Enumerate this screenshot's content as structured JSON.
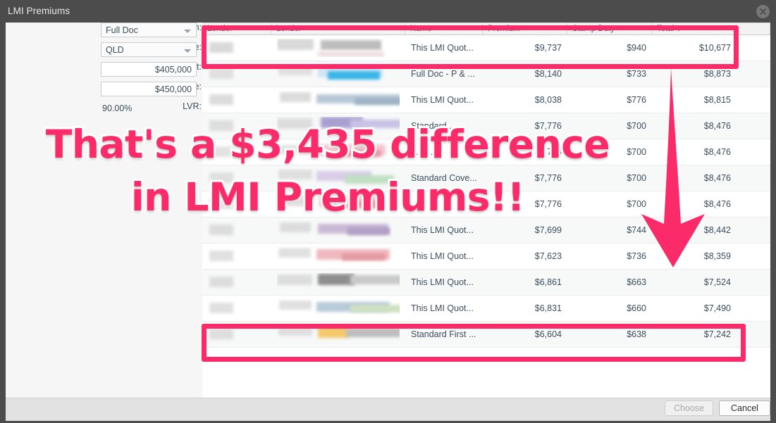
{
  "window": {
    "title": "LMI Premiums",
    "close_icon": "close-circle-icon"
  },
  "form": {
    "fields": [
      {
        "label": "Income Verification:",
        "value": "Full Doc",
        "type": "select"
      },
      {
        "label": "State:",
        "value": "QLD",
        "type": "select"
      },
      {
        "label": "Loan Amount:",
        "value": "$405,000",
        "type": "text"
      },
      {
        "label": "Security Value:",
        "value": "$450,000",
        "type": "text"
      },
      {
        "label": "LVR:",
        "value": "90.00%",
        "type": "static"
      }
    ]
  },
  "table": {
    "columns": [
      "Lender",
      "Lender",
      "Name",
      "Premium",
      "Stamp Duty",
      "Total",
      ""
    ],
    "sort_column": "Total",
    "sort_direction": "descending",
    "sort_arrow": "↓",
    "rows": [
      {
        "name": "This LMI Quot...",
        "premium": "$9,737",
        "stamp_duty": "$940",
        "total": "$10,677"
      },
      {
        "name": "Full Doc - P & ...",
        "premium": "$8,140",
        "stamp_duty": "$733",
        "total": "$8,873"
      },
      {
        "name": "This LMI Quot...",
        "premium": "$8,038",
        "stamp_duty": "$776",
        "total": "$8,815"
      },
      {
        "name": "Standard ...",
        "premium": "$7,776",
        "stamp_duty": "$700",
        "total": "$8,476"
      },
      {
        "name": "...an ...",
        "premium": "$7,776",
        "stamp_duty": "$700",
        "total": "$8,476"
      },
      {
        "name": "Standard Cove...",
        "premium": "$7,776",
        "stamp_duty": "$700",
        "total": "$8,476"
      },
      {
        "name": "",
        "premium": "$7,776",
        "stamp_duty": "$700",
        "total": "$8,476"
      },
      {
        "name": "This LMI Quot...",
        "premium": "$7,699",
        "stamp_duty": "$744",
        "total": "$8,442"
      },
      {
        "name": "This LMI Quot...",
        "premium": "$7,623",
        "stamp_duty": "$736",
        "total": "$8,359"
      },
      {
        "name": "This LMI Quot...",
        "premium": "$6,861",
        "stamp_duty": "$663",
        "total": "$7,524"
      },
      {
        "name": "This LMI Quot...",
        "premium": "$6,831",
        "stamp_duty": "$660",
        "total": "$7,490"
      },
      {
        "name": "Standard First ...",
        "premium": "$6,604",
        "stamp_duty": "$638",
        "total": "$7,242"
      }
    ]
  },
  "annotation": {
    "line1": "That's a $3,435 difference",
    "line2": "in LMI Premiums!!",
    "color": "#fa2b68",
    "arrow_icon": "down-arrow-icon"
  },
  "buttons": {
    "choose": "Choose",
    "cancel": "Cancel"
  }
}
